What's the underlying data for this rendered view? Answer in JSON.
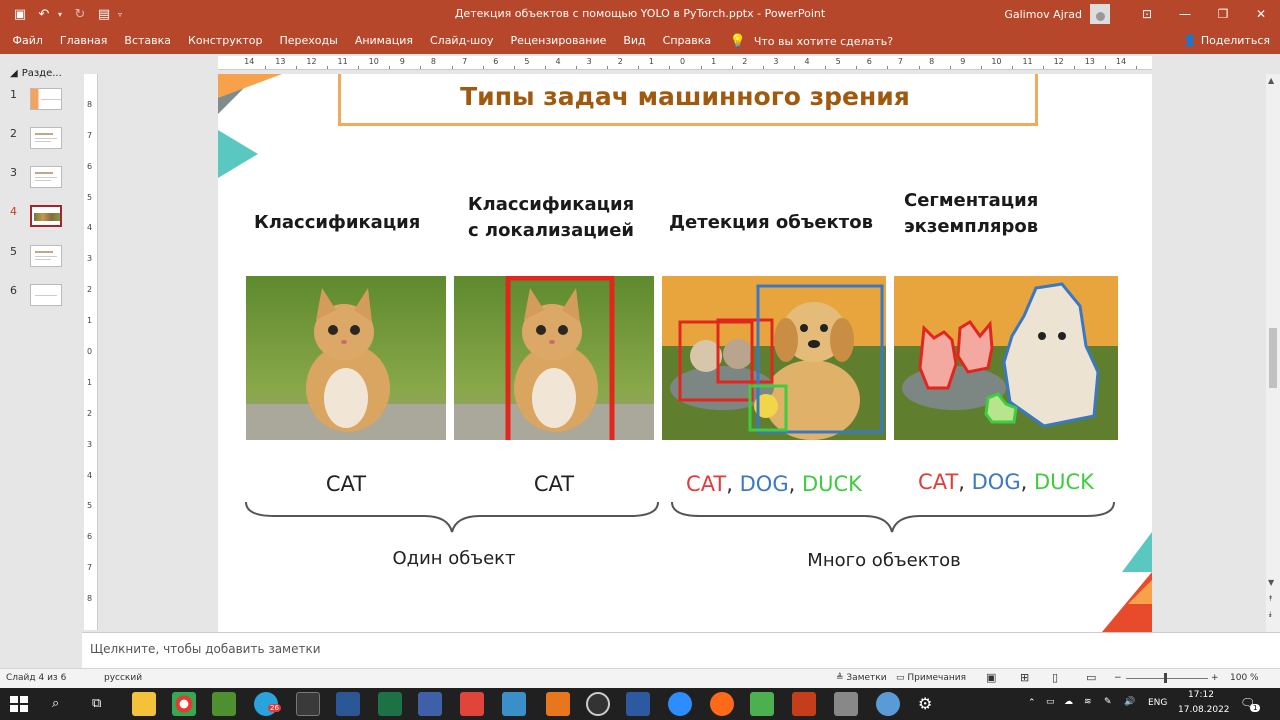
{
  "window": {
    "title": "Детекция объектов с помощью YOLO в PyTorch.pptx  -  PowerPoint",
    "user": "Galimov Ajrad"
  },
  "ribbon": {
    "tabs": [
      "Файл",
      "Главная",
      "Вставка",
      "Конструктор",
      "Переходы",
      "Анимация",
      "Слайд-шоу",
      "Рецензирование",
      "Вид",
      "Справка"
    ],
    "tell_me": "Что вы хотите сделать?",
    "share": "Поделиться"
  },
  "thumbnails": {
    "section": "Разде...",
    "slides": [
      "1",
      "2",
      "3",
      "4",
      "5",
      "6"
    ],
    "active": 4
  },
  "ruler": {
    "h_numbers": [
      "14",
      "13",
      "12",
      "11",
      "10",
      "9",
      "8",
      "7",
      "6",
      "5",
      "4",
      "3",
      "2",
      "1",
      "0",
      "1",
      "2",
      "3",
      "4",
      "5",
      "6",
      "7",
      "8",
      "9",
      "10",
      "11",
      "12",
      "13",
      "14"
    ],
    "v_numbers": [
      "8",
      "7",
      "6",
      "5",
      "4",
      "3",
      "2",
      "1",
      "0",
      "1",
      "2",
      "3",
      "4",
      "5",
      "6",
      "7",
      "8"
    ]
  },
  "slide": {
    "title": "Типы задач машинного зрения",
    "columns": [
      {
        "header": "Классификация",
        "label": "CAT"
      },
      {
        "header": "Классификация\nс локализацией",
        "label": "CAT"
      },
      {
        "header": "Детекция объектов",
        "label": "CAT, DOG, DUCK"
      },
      {
        "header": "Сегментация\nэкземпляров",
        "label": "CAT, DOG, DUCK"
      }
    ],
    "multi_label": {
      "cat": "CAT",
      "dog": "DOG",
      "duck": "DUCK",
      "sep": ", "
    },
    "group_single": "Один объект",
    "group_multi": "Много объектов",
    "colors": {
      "cat": "#e23b3b",
      "dog": "#3b78c4",
      "duck": "#3fcc3f",
      "title": "#a05a10"
    }
  },
  "notes": {
    "placeholder": "Щелкните, чтобы добавить заметки"
  },
  "status": {
    "slide": "Слайд 4 из 6",
    "lang": "русский",
    "notes_btn": "Заметки",
    "comments_btn": "Примечания",
    "zoom": "100 %"
  },
  "taskbar": {
    "lang": "ENG",
    "time": "17:12",
    "date": "17.08.2022",
    "notif": "1",
    "telegram_badge": "26"
  }
}
